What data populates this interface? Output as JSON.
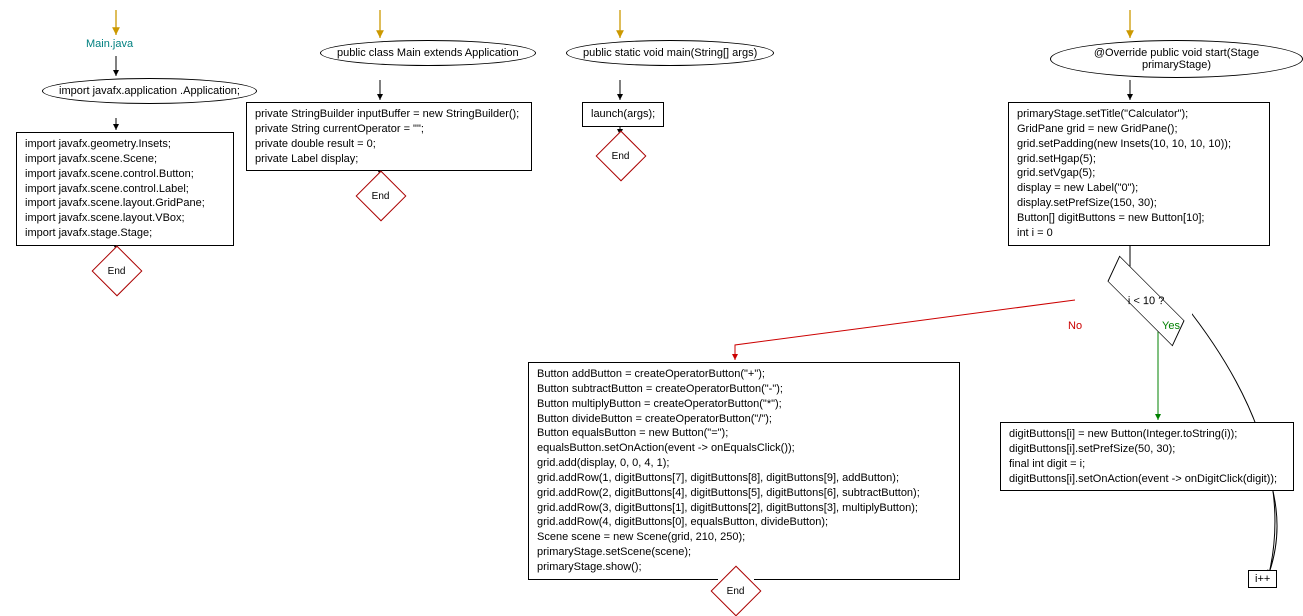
{
  "col1": {
    "title": "Main.java",
    "ellipse": "import javafx.application\n.Application;",
    "rect": "import javafx.geometry.Insets;\nimport javafx.scene.Scene;\nimport javafx.scene.control.Button;\nimport javafx.scene.control.Label;\nimport javafx.scene.layout.GridPane;\nimport javafx.scene.layout.VBox;\nimport javafx.stage.Stage;",
    "end": "End"
  },
  "col2": {
    "ellipse": "public class Main\nextends Application",
    "rect": "private StringBuilder inputBuffer = new StringBuilder();\nprivate String currentOperator = \"\";\nprivate double result = 0;\nprivate Label display;",
    "end": "End"
  },
  "col3": {
    "ellipse": "public static void\nmain(String[] args)",
    "rect": "launch(args);",
    "end": "End"
  },
  "col4": {
    "ellipse": "@Override public void\nstart(Stage primaryStage)",
    "rect1": "primaryStage.setTitle(\"Calculator\");\nGridPane grid = new GridPane();\ngrid.setPadding(new Insets(10, 10, 10, 10));\ngrid.setHgap(5);\ngrid.setVgap(5);\ndisplay = new Label(\"0\");\ndisplay.setPrefSize(150, 30);\nButton[] digitButtons = new Button[10];\nint i = 0",
    "decision": "i < 10 ?",
    "no": "No",
    "yes": "Yes",
    "loop_body": "digitButtons[i] = new Button(Integer.toString(i));\ndigitButtons[i].setPrefSize(50, 30);\nfinal int digit = i;\ndigitButtons[i].setOnAction(event -> onDigitClick(digit));",
    "increment": "i++",
    "after_loop": "Button addButton = createOperatorButton(\"+\");\nButton subtractButton = createOperatorButton(\"-\");\nButton multiplyButton = createOperatorButton(\"*\");\nButton divideButton = createOperatorButton(\"/\");\nButton equalsButton = new Button(\"=\");\nequalsButton.setOnAction(event -> onEqualsClick());\ngrid.add(display, 0, 0, 4, 1);\ngrid.addRow(1, digitButtons[7], digitButtons[8], digitButtons[9], addButton);\ngrid.addRow(2, digitButtons[4], digitButtons[5], digitButtons[6], subtractButton);\ngrid.addRow(3, digitButtons[1], digitButtons[2], digitButtons[3], multiplyButton);\ngrid.addRow(4, digitButtons[0], equalsButton, divideButton);\nScene scene = new Scene(grid, 210, 250);\nprimaryStage.setScene(scene);\nprimaryStage.show();",
    "end": "End"
  }
}
